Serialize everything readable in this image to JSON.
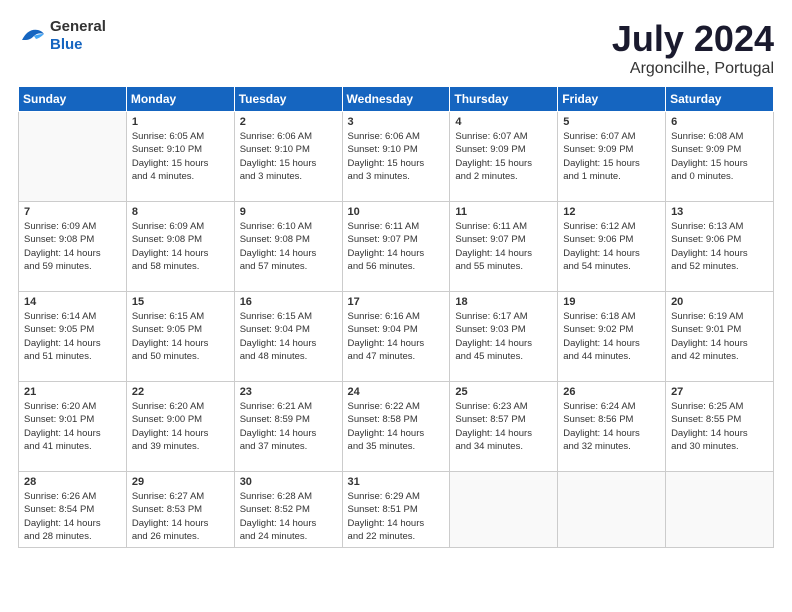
{
  "header": {
    "logo_general": "General",
    "logo_blue": "Blue",
    "title": "July 2024",
    "subtitle": "Argoncilhe, Portugal"
  },
  "days_of_week": [
    "Sunday",
    "Monday",
    "Tuesday",
    "Wednesday",
    "Thursday",
    "Friday",
    "Saturday"
  ],
  "weeks": [
    [
      {
        "date": "",
        "info": ""
      },
      {
        "date": "1",
        "info": "Sunrise: 6:05 AM\nSunset: 9:10 PM\nDaylight: 15 hours\nand 4 minutes."
      },
      {
        "date": "2",
        "info": "Sunrise: 6:06 AM\nSunset: 9:10 PM\nDaylight: 15 hours\nand 3 minutes."
      },
      {
        "date": "3",
        "info": "Sunrise: 6:06 AM\nSunset: 9:10 PM\nDaylight: 15 hours\nand 3 minutes."
      },
      {
        "date": "4",
        "info": "Sunrise: 6:07 AM\nSunset: 9:09 PM\nDaylight: 15 hours\nand 2 minutes."
      },
      {
        "date": "5",
        "info": "Sunrise: 6:07 AM\nSunset: 9:09 PM\nDaylight: 15 hours\nand 1 minute."
      },
      {
        "date": "6",
        "info": "Sunrise: 6:08 AM\nSunset: 9:09 PM\nDaylight: 15 hours\nand 0 minutes."
      }
    ],
    [
      {
        "date": "7",
        "info": "Sunrise: 6:09 AM\nSunset: 9:08 PM\nDaylight: 14 hours\nand 59 minutes."
      },
      {
        "date": "8",
        "info": "Sunrise: 6:09 AM\nSunset: 9:08 PM\nDaylight: 14 hours\nand 58 minutes."
      },
      {
        "date": "9",
        "info": "Sunrise: 6:10 AM\nSunset: 9:08 PM\nDaylight: 14 hours\nand 57 minutes."
      },
      {
        "date": "10",
        "info": "Sunrise: 6:11 AM\nSunset: 9:07 PM\nDaylight: 14 hours\nand 56 minutes."
      },
      {
        "date": "11",
        "info": "Sunrise: 6:11 AM\nSunset: 9:07 PM\nDaylight: 14 hours\nand 55 minutes."
      },
      {
        "date": "12",
        "info": "Sunrise: 6:12 AM\nSunset: 9:06 PM\nDaylight: 14 hours\nand 54 minutes."
      },
      {
        "date": "13",
        "info": "Sunrise: 6:13 AM\nSunset: 9:06 PM\nDaylight: 14 hours\nand 52 minutes."
      }
    ],
    [
      {
        "date": "14",
        "info": "Sunrise: 6:14 AM\nSunset: 9:05 PM\nDaylight: 14 hours\nand 51 minutes."
      },
      {
        "date": "15",
        "info": "Sunrise: 6:15 AM\nSunset: 9:05 PM\nDaylight: 14 hours\nand 50 minutes."
      },
      {
        "date": "16",
        "info": "Sunrise: 6:15 AM\nSunset: 9:04 PM\nDaylight: 14 hours\nand 48 minutes."
      },
      {
        "date": "17",
        "info": "Sunrise: 6:16 AM\nSunset: 9:04 PM\nDaylight: 14 hours\nand 47 minutes."
      },
      {
        "date": "18",
        "info": "Sunrise: 6:17 AM\nSunset: 9:03 PM\nDaylight: 14 hours\nand 45 minutes."
      },
      {
        "date": "19",
        "info": "Sunrise: 6:18 AM\nSunset: 9:02 PM\nDaylight: 14 hours\nand 44 minutes."
      },
      {
        "date": "20",
        "info": "Sunrise: 6:19 AM\nSunset: 9:01 PM\nDaylight: 14 hours\nand 42 minutes."
      }
    ],
    [
      {
        "date": "21",
        "info": "Sunrise: 6:20 AM\nSunset: 9:01 PM\nDaylight: 14 hours\nand 41 minutes."
      },
      {
        "date": "22",
        "info": "Sunrise: 6:20 AM\nSunset: 9:00 PM\nDaylight: 14 hours\nand 39 minutes."
      },
      {
        "date": "23",
        "info": "Sunrise: 6:21 AM\nSunset: 8:59 PM\nDaylight: 14 hours\nand 37 minutes."
      },
      {
        "date": "24",
        "info": "Sunrise: 6:22 AM\nSunset: 8:58 PM\nDaylight: 14 hours\nand 35 minutes."
      },
      {
        "date": "25",
        "info": "Sunrise: 6:23 AM\nSunset: 8:57 PM\nDaylight: 14 hours\nand 34 minutes."
      },
      {
        "date": "26",
        "info": "Sunrise: 6:24 AM\nSunset: 8:56 PM\nDaylight: 14 hours\nand 32 minutes."
      },
      {
        "date": "27",
        "info": "Sunrise: 6:25 AM\nSunset: 8:55 PM\nDaylight: 14 hours\nand 30 minutes."
      }
    ],
    [
      {
        "date": "28",
        "info": "Sunrise: 6:26 AM\nSunset: 8:54 PM\nDaylight: 14 hours\nand 28 minutes."
      },
      {
        "date": "29",
        "info": "Sunrise: 6:27 AM\nSunset: 8:53 PM\nDaylight: 14 hours\nand 26 minutes."
      },
      {
        "date": "30",
        "info": "Sunrise: 6:28 AM\nSunset: 8:52 PM\nDaylight: 14 hours\nand 24 minutes."
      },
      {
        "date": "31",
        "info": "Sunrise: 6:29 AM\nSunset: 8:51 PM\nDaylight: 14 hours\nand 22 minutes."
      },
      {
        "date": "",
        "info": ""
      },
      {
        "date": "",
        "info": ""
      },
      {
        "date": "",
        "info": ""
      }
    ]
  ]
}
